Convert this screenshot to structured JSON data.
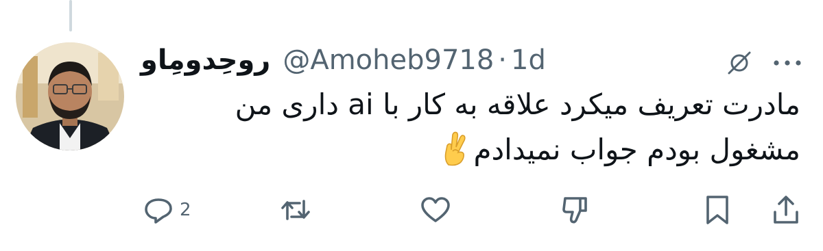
{
  "author": {
    "display_name": "روحِدومِاو",
    "handle": "@Amoheb9718",
    "separator": "·",
    "timestamp": "1d"
  },
  "tweet": {
    "lines": [
      "مادرت تعریف میکرد علاقه به کار با ai داری من",
      "مشغول بودم جواب نمیدادم"
    ],
    "emoji": "🤞"
  },
  "actions": {
    "reply_count": "2"
  },
  "icons": {
    "grok": "grok-icon",
    "more": "more-icon",
    "reply": "reply-icon",
    "retweet": "retweet-icon",
    "like": "heart-icon",
    "dislike": "thumbs-down-icon",
    "bookmark": "bookmark-icon",
    "share": "share-icon"
  },
  "colors": {
    "text_primary": "#0f1419",
    "text_secondary": "#536471",
    "thread_line": "#cfd9de",
    "background": "#ffffff"
  }
}
